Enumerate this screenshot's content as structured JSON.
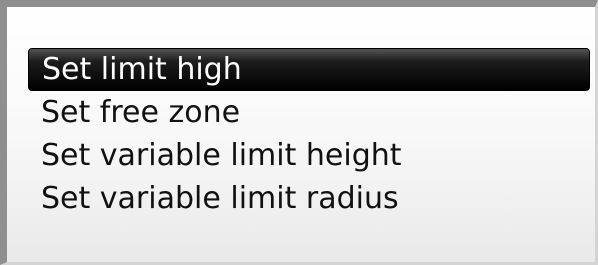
{
  "menu": {
    "selected_index": 0,
    "items": [
      {
        "label": "Set limit high"
      },
      {
        "label": "Set free zone"
      },
      {
        "label": "Set variable limit height"
      },
      {
        "label": "Set variable limit radius"
      }
    ]
  }
}
